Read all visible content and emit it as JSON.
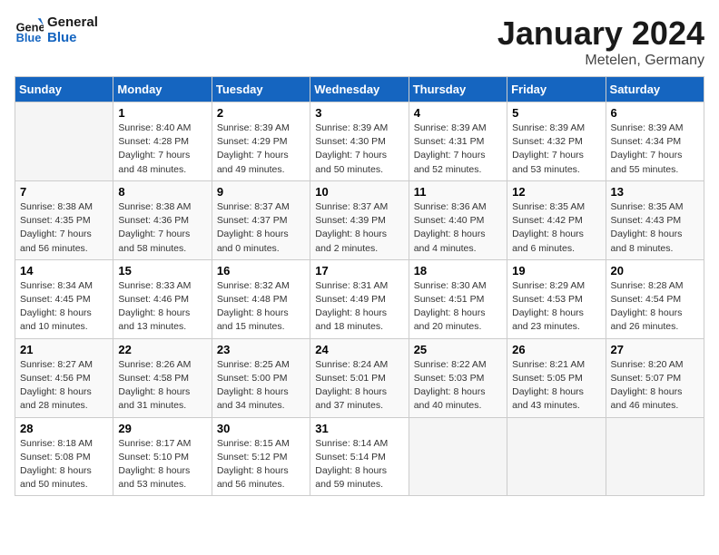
{
  "logo": {
    "line1": "General",
    "line2": "Blue"
  },
  "title": "January 2024",
  "subtitle": "Metelen, Germany",
  "days_header": [
    "Sunday",
    "Monday",
    "Tuesday",
    "Wednesday",
    "Thursday",
    "Friday",
    "Saturday"
  ],
  "weeks": [
    [
      {
        "day": "",
        "sunrise": "",
        "sunset": "",
        "daylight": ""
      },
      {
        "day": "1",
        "sunrise": "Sunrise: 8:40 AM",
        "sunset": "Sunset: 4:28 PM",
        "daylight": "Daylight: 7 hours and 48 minutes."
      },
      {
        "day": "2",
        "sunrise": "Sunrise: 8:39 AM",
        "sunset": "Sunset: 4:29 PM",
        "daylight": "Daylight: 7 hours and 49 minutes."
      },
      {
        "day": "3",
        "sunrise": "Sunrise: 8:39 AM",
        "sunset": "Sunset: 4:30 PM",
        "daylight": "Daylight: 7 hours and 50 minutes."
      },
      {
        "day": "4",
        "sunrise": "Sunrise: 8:39 AM",
        "sunset": "Sunset: 4:31 PM",
        "daylight": "Daylight: 7 hours and 52 minutes."
      },
      {
        "day": "5",
        "sunrise": "Sunrise: 8:39 AM",
        "sunset": "Sunset: 4:32 PM",
        "daylight": "Daylight: 7 hours and 53 minutes."
      },
      {
        "day": "6",
        "sunrise": "Sunrise: 8:39 AM",
        "sunset": "Sunset: 4:34 PM",
        "daylight": "Daylight: 7 hours and 55 minutes."
      }
    ],
    [
      {
        "day": "7",
        "sunrise": "Sunrise: 8:38 AM",
        "sunset": "Sunset: 4:35 PM",
        "daylight": "Daylight: 7 hours and 56 minutes."
      },
      {
        "day": "8",
        "sunrise": "Sunrise: 8:38 AM",
        "sunset": "Sunset: 4:36 PM",
        "daylight": "Daylight: 7 hours and 58 minutes."
      },
      {
        "day": "9",
        "sunrise": "Sunrise: 8:37 AM",
        "sunset": "Sunset: 4:37 PM",
        "daylight": "Daylight: 8 hours and 0 minutes."
      },
      {
        "day": "10",
        "sunrise": "Sunrise: 8:37 AM",
        "sunset": "Sunset: 4:39 PM",
        "daylight": "Daylight: 8 hours and 2 minutes."
      },
      {
        "day": "11",
        "sunrise": "Sunrise: 8:36 AM",
        "sunset": "Sunset: 4:40 PM",
        "daylight": "Daylight: 8 hours and 4 minutes."
      },
      {
        "day": "12",
        "sunrise": "Sunrise: 8:35 AM",
        "sunset": "Sunset: 4:42 PM",
        "daylight": "Daylight: 8 hours and 6 minutes."
      },
      {
        "day": "13",
        "sunrise": "Sunrise: 8:35 AM",
        "sunset": "Sunset: 4:43 PM",
        "daylight": "Daylight: 8 hours and 8 minutes."
      }
    ],
    [
      {
        "day": "14",
        "sunrise": "Sunrise: 8:34 AM",
        "sunset": "Sunset: 4:45 PM",
        "daylight": "Daylight: 8 hours and 10 minutes."
      },
      {
        "day": "15",
        "sunrise": "Sunrise: 8:33 AM",
        "sunset": "Sunset: 4:46 PM",
        "daylight": "Daylight: 8 hours and 13 minutes."
      },
      {
        "day": "16",
        "sunrise": "Sunrise: 8:32 AM",
        "sunset": "Sunset: 4:48 PM",
        "daylight": "Daylight: 8 hours and 15 minutes."
      },
      {
        "day": "17",
        "sunrise": "Sunrise: 8:31 AM",
        "sunset": "Sunset: 4:49 PM",
        "daylight": "Daylight: 8 hours and 18 minutes."
      },
      {
        "day": "18",
        "sunrise": "Sunrise: 8:30 AM",
        "sunset": "Sunset: 4:51 PM",
        "daylight": "Daylight: 8 hours and 20 minutes."
      },
      {
        "day": "19",
        "sunrise": "Sunrise: 8:29 AM",
        "sunset": "Sunset: 4:53 PM",
        "daylight": "Daylight: 8 hours and 23 minutes."
      },
      {
        "day": "20",
        "sunrise": "Sunrise: 8:28 AM",
        "sunset": "Sunset: 4:54 PM",
        "daylight": "Daylight: 8 hours and 26 minutes."
      }
    ],
    [
      {
        "day": "21",
        "sunrise": "Sunrise: 8:27 AM",
        "sunset": "Sunset: 4:56 PM",
        "daylight": "Daylight: 8 hours and 28 minutes."
      },
      {
        "day": "22",
        "sunrise": "Sunrise: 8:26 AM",
        "sunset": "Sunset: 4:58 PM",
        "daylight": "Daylight: 8 hours and 31 minutes."
      },
      {
        "day": "23",
        "sunrise": "Sunrise: 8:25 AM",
        "sunset": "Sunset: 5:00 PM",
        "daylight": "Daylight: 8 hours and 34 minutes."
      },
      {
        "day": "24",
        "sunrise": "Sunrise: 8:24 AM",
        "sunset": "Sunset: 5:01 PM",
        "daylight": "Daylight: 8 hours and 37 minutes."
      },
      {
        "day": "25",
        "sunrise": "Sunrise: 8:22 AM",
        "sunset": "Sunset: 5:03 PM",
        "daylight": "Daylight: 8 hours and 40 minutes."
      },
      {
        "day": "26",
        "sunrise": "Sunrise: 8:21 AM",
        "sunset": "Sunset: 5:05 PM",
        "daylight": "Daylight: 8 hours and 43 minutes."
      },
      {
        "day": "27",
        "sunrise": "Sunrise: 8:20 AM",
        "sunset": "Sunset: 5:07 PM",
        "daylight": "Daylight: 8 hours and 46 minutes."
      }
    ],
    [
      {
        "day": "28",
        "sunrise": "Sunrise: 8:18 AM",
        "sunset": "Sunset: 5:08 PM",
        "daylight": "Daylight: 8 hours and 50 minutes."
      },
      {
        "day": "29",
        "sunrise": "Sunrise: 8:17 AM",
        "sunset": "Sunset: 5:10 PM",
        "daylight": "Daylight: 8 hours and 53 minutes."
      },
      {
        "day": "30",
        "sunrise": "Sunrise: 8:15 AM",
        "sunset": "Sunset: 5:12 PM",
        "daylight": "Daylight: 8 hours and 56 minutes."
      },
      {
        "day": "31",
        "sunrise": "Sunrise: 8:14 AM",
        "sunset": "Sunset: 5:14 PM",
        "daylight": "Daylight: 8 hours and 59 minutes."
      },
      {
        "day": "",
        "sunrise": "",
        "sunset": "",
        "daylight": ""
      },
      {
        "day": "",
        "sunrise": "",
        "sunset": "",
        "daylight": ""
      },
      {
        "day": "",
        "sunrise": "",
        "sunset": "",
        "daylight": ""
      }
    ]
  ]
}
